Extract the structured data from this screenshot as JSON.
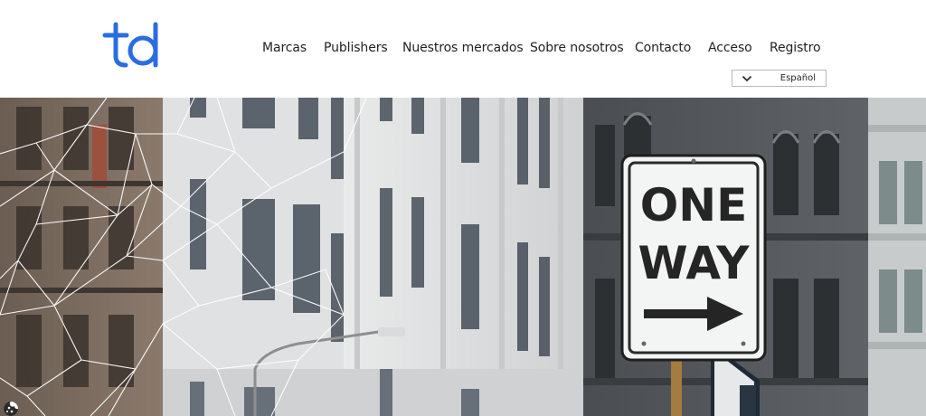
{
  "brand": {
    "logo_text": "td",
    "accent": "#2b6de0"
  },
  "nav": {
    "items": [
      {
        "label": "Marcas"
      },
      {
        "label": "Publishers"
      },
      {
        "label": "Nuestros mercados"
      },
      {
        "label": "Sobre nosotros"
      },
      {
        "label": "Contacto"
      },
      {
        "label": "Acceso"
      },
      {
        "label": "Registro"
      }
    ]
  },
  "language": {
    "selected": "Español",
    "icon": "chevron-down-icon"
  },
  "hero": {
    "sign": {
      "line1": "ONE",
      "line2": "WAY",
      "icon": "arrow-right-icon"
    },
    "overlay": "geometric-line-pattern"
  },
  "cookie": {
    "icon": "cookie-icon"
  }
}
